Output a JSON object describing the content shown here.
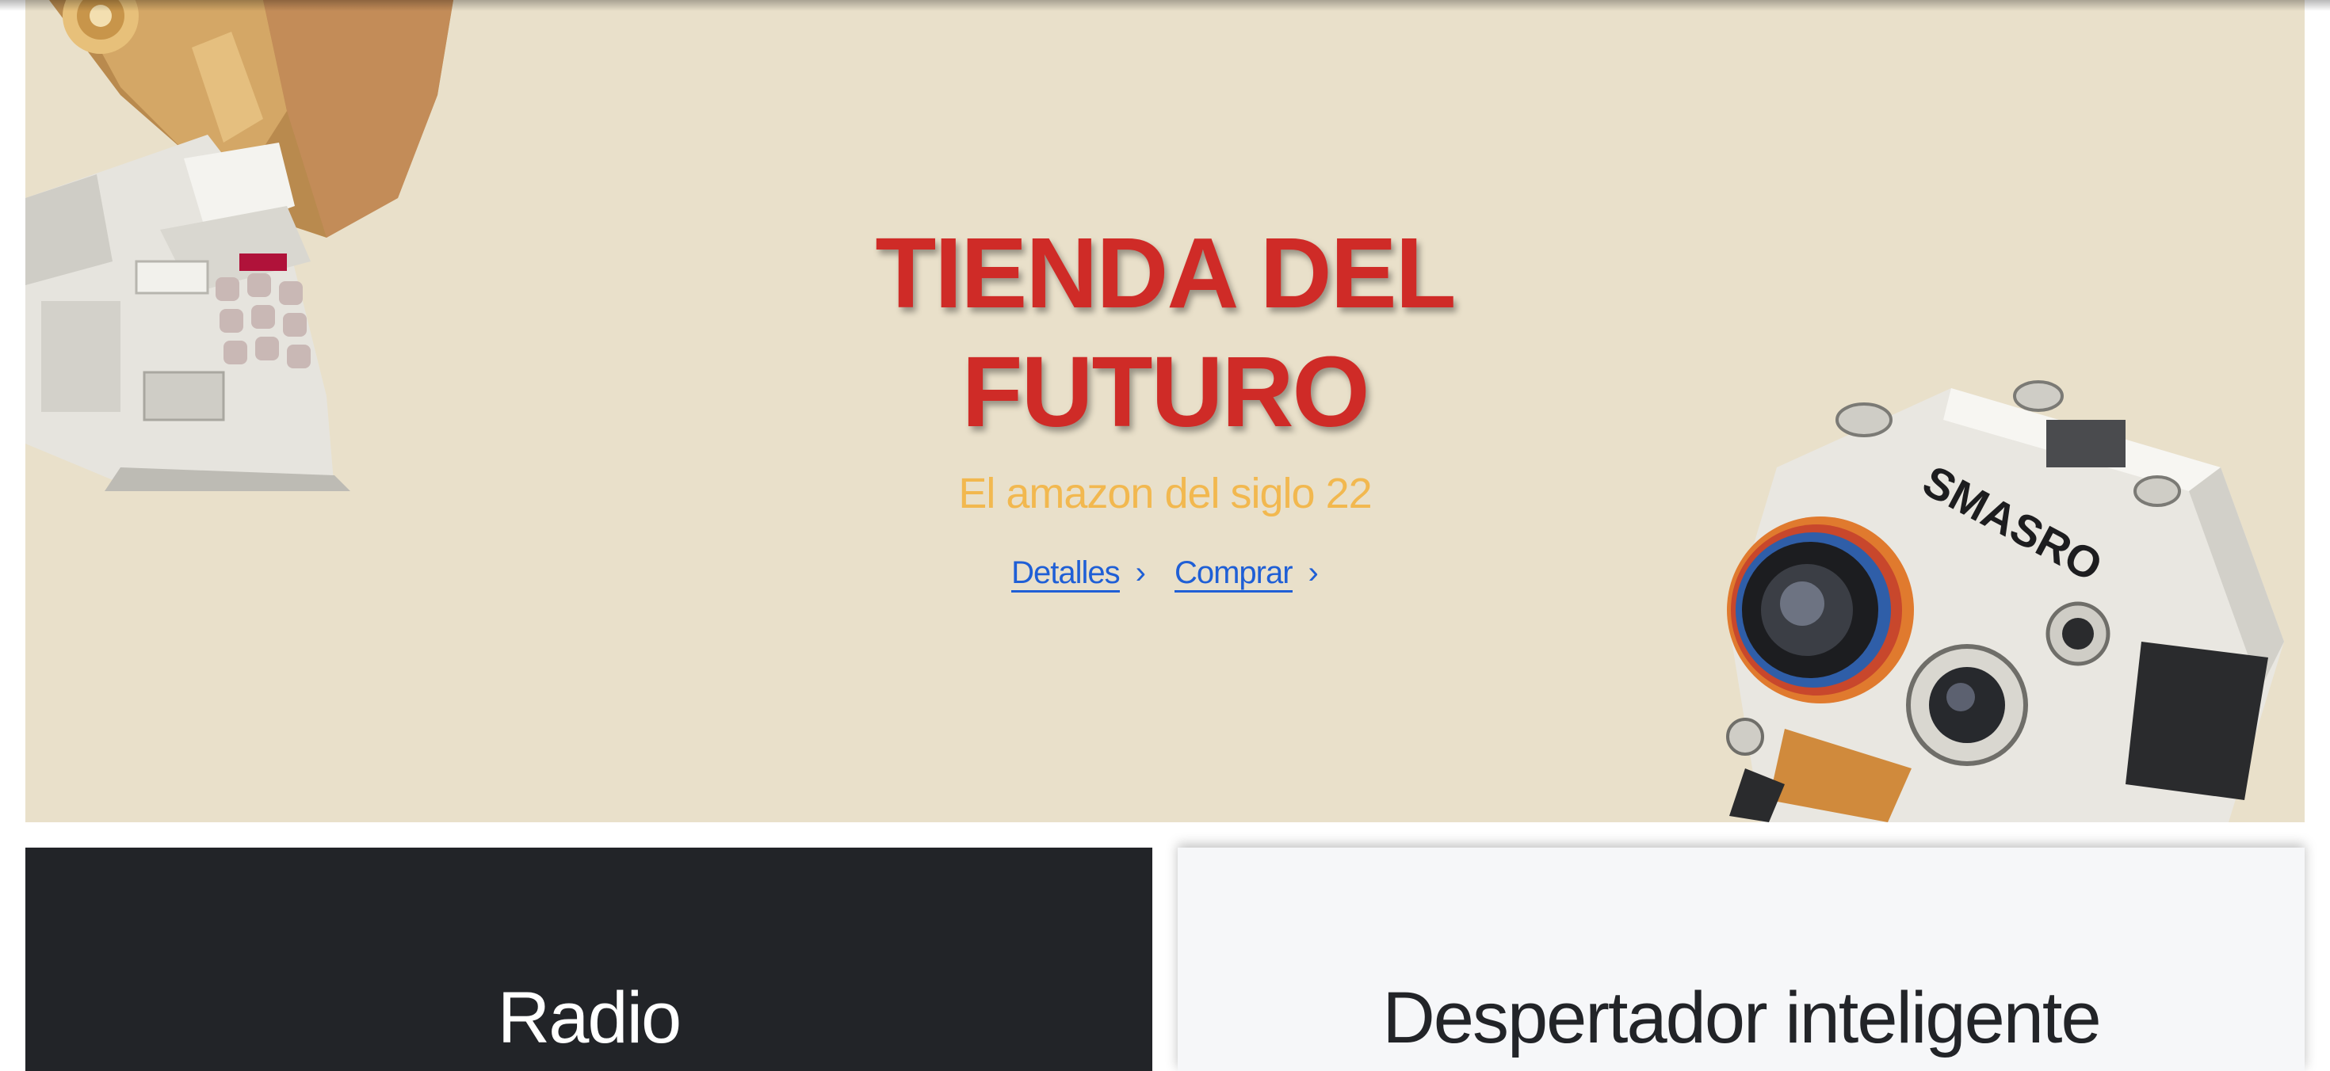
{
  "hero": {
    "title_line1": "TIENDA DEL",
    "title_line2": "FUTURO",
    "subtitle": "El amazon del siglo 22",
    "links": [
      {
        "label": "Detalles"
      },
      {
        "label": "Comprar"
      }
    ],
    "chevron_icon": "chevron-right-icon",
    "colors": {
      "background": "#e9e0ca",
      "title": "#cf2b27",
      "subtitle": "#f2b84f",
      "link": "#1f5fd6"
    },
    "product_images": [
      "retro-appliance-image",
      "retro-camera-robot-image"
    ]
  },
  "cards": [
    {
      "title": "Radio",
      "theme": "dark",
      "background": "#222428"
    },
    {
      "title": "Despertador inteligente",
      "theme": "light",
      "background": "#f6f7f9"
    }
  ]
}
